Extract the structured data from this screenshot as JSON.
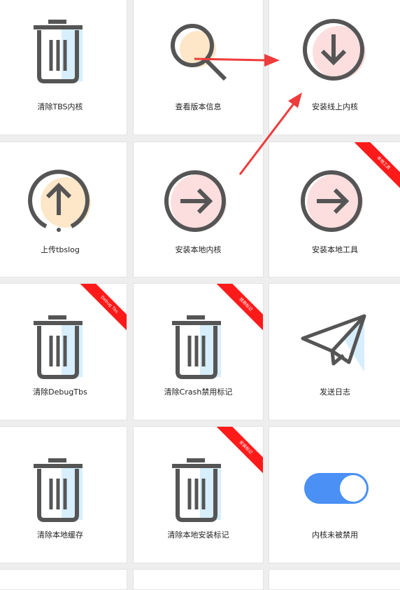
{
  "tiles": [
    {
      "label": "清除TBS内核"
    },
    {
      "label": "查看版本信息"
    },
    {
      "label": "安装线上内核"
    },
    {
      "label": "上传tbslog"
    },
    {
      "label": "安装本地内核"
    },
    {
      "label": "安装本地工具",
      "ribbon": "本地工具"
    },
    {
      "label": "清除DebugTbs",
      "ribbon": "Debug Tbs"
    },
    {
      "label": "清除Crash禁用标记",
      "ribbon": "禁用标记"
    },
    {
      "label": "发送日志"
    },
    {
      "label": "清除本地缓存"
    },
    {
      "label": "清除本地安装标记",
      "ribbon": "安装标记"
    },
    {
      "label": "内核未被禁用"
    }
  ],
  "colors": {
    "accent_red": "#ff1a1a",
    "icon_stroke": "#555555",
    "tint_blue": "#d7eefc",
    "tint_peach": "#fde7c8",
    "tint_pink": "#fddede",
    "toggle_blue": "#4a90f5"
  }
}
